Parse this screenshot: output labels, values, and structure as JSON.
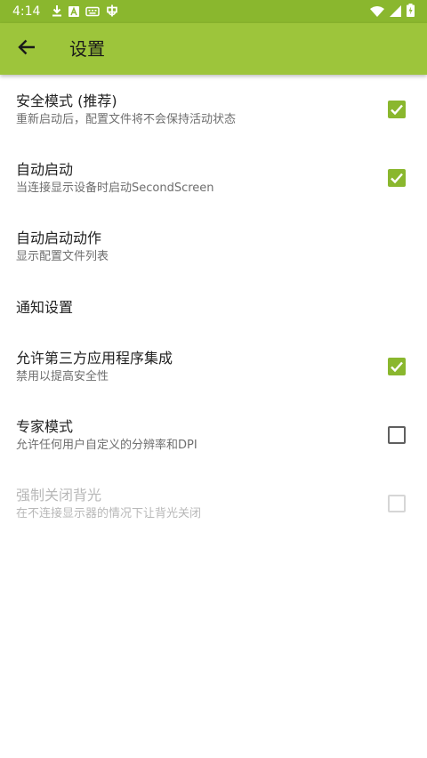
{
  "status_bar": {
    "time": "4:14",
    "icons_left": [
      "download-icon",
      "font-app-icon",
      "keyboard-icon",
      "bug-icon"
    ],
    "icons_right": [
      "wifi-icon",
      "signal-icon",
      "battery-charging-icon"
    ]
  },
  "app_bar": {
    "title": "设置",
    "back_icon": "arrow-back-icon"
  },
  "colors": {
    "status_bar": "#8ab72e",
    "app_bar": "#9dc53b",
    "accent": "#8ab72e"
  },
  "settings": [
    {
      "title": "安全模式 (推荐)",
      "subtitle": "重新启动后，配置文件将不会保持活动状态",
      "checkbox": "checked"
    },
    {
      "title": "自动启动",
      "subtitle": "当连接显示设备时启动SecondScreen",
      "checkbox": "checked"
    },
    {
      "title": "自动启动动作",
      "subtitle": "显示配置文件列表"
    },
    {
      "title": "通知设置"
    },
    {
      "title": "允许第三方应用程序集成",
      "subtitle": "禁用以提高安全性",
      "checkbox": "checked"
    },
    {
      "title": "专家模式",
      "subtitle": "允许任何用户自定义的分辨率和DPI",
      "checkbox": "unchecked"
    },
    {
      "title": "强制关闭背光",
      "subtitle": "在不连接显示器的情况下让背光关闭",
      "checkbox": "disabled-unchecked"
    }
  ]
}
